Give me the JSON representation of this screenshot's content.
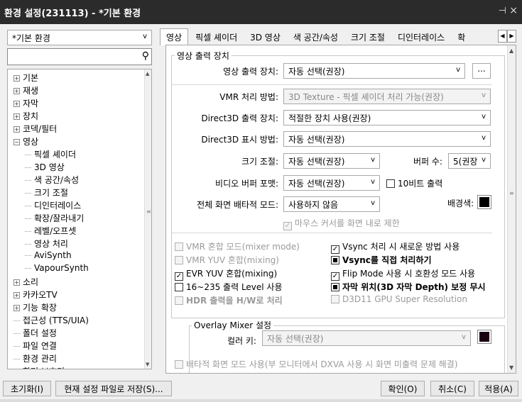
{
  "window": {
    "title": "환경 설정(231113) - *기본 환경",
    "pin_glyph": "⊣",
    "close_glyph": "×"
  },
  "left": {
    "profile": "*기본 환경",
    "search_placeholder": "",
    "tree": [
      {
        "label": "기본",
        "exp": "+",
        "indent": 0
      },
      {
        "label": "재생",
        "exp": "+",
        "indent": 0
      },
      {
        "label": "자막",
        "exp": "+",
        "indent": 0
      },
      {
        "label": "장치",
        "exp": "+",
        "indent": 0
      },
      {
        "label": "코덱/필터",
        "exp": "+",
        "indent": 0
      },
      {
        "label": "영상",
        "exp": "−",
        "indent": 0
      },
      {
        "label": "픽셀 셰이더",
        "exp": "",
        "indent": 1
      },
      {
        "label": "3D 영상",
        "exp": "",
        "indent": 1
      },
      {
        "label": "색 공간/속성",
        "exp": "",
        "indent": 1
      },
      {
        "label": "크기 조절",
        "exp": "",
        "indent": 1
      },
      {
        "label": "디인터레이스",
        "exp": "",
        "indent": 1
      },
      {
        "label": "확장/잘라내기",
        "exp": "",
        "indent": 1
      },
      {
        "label": "레벨/오프셋",
        "exp": "",
        "indent": 1
      },
      {
        "label": "영상 처리",
        "exp": "",
        "indent": 1
      },
      {
        "label": "AviSynth",
        "exp": "",
        "indent": 1
      },
      {
        "label": "VapourSynth",
        "exp": "",
        "indent": 1
      },
      {
        "label": "소리",
        "exp": "+",
        "indent": 0
      },
      {
        "label": "카카오TV",
        "exp": "+",
        "indent": 0
      },
      {
        "label": "기능 확장",
        "exp": "+",
        "indent": 0
      },
      {
        "label": "접근성 (TTS/UIA)",
        "exp": "",
        "indent": 0
      },
      {
        "label": "폴더 설정",
        "exp": "",
        "indent": 0
      },
      {
        "label": "파일 연결",
        "exp": "",
        "indent": 0
      },
      {
        "label": "환경 관리",
        "exp": "",
        "indent": 0
      },
      {
        "label": "화면 보호기",
        "exp": "",
        "indent": 0
      }
    ]
  },
  "tabs": [
    "영상",
    "픽셀 셰이더",
    "3D 영상",
    "색 공간/속성",
    "크기 조절",
    "디인터레이스",
    "확"
  ],
  "tabs_active_index": 0,
  "output_group": {
    "title": "영상 출력 장치",
    "device_label": "영상 출력 장치:",
    "device_value": "자동 선택(권장)",
    "browse_label": "...",
    "vmr_label": "VMR 처리 방법:",
    "vmr_value": "3D Texture - 픽셀 셰이더 처리 가능(권장)",
    "d3d_device_label": "Direct3D 출력 장치:",
    "d3d_device_value": "적절한 장치 사용(권장)",
    "d3d_present_label": "Direct3D 표시 방법:",
    "d3d_present_value": "자동 선택(권장)",
    "resize_label": "크기 조절:",
    "resize_value": "자동 선택(권장)",
    "buffer_label": "버퍼 수:",
    "buffer_value": "5(권장",
    "vbuf_label": "비디오 버퍼 포맷:",
    "vbuf_value": "자동 선택(권장)",
    "tenbit_label": "10비트 출력",
    "fs_label": "전체 화면 배타적 모드:",
    "fs_value": "사용하지 않음",
    "bg_label": "배경색:",
    "bg_color": "#000000",
    "mouse_label": "마우스 커서를 화면 내로 제한",
    "checks": [
      {
        "label": "VMR 혼합 모드(mixer mode)",
        "state": "off",
        "enabled": false,
        "bold": false
      },
      {
        "label": "Vsync 처리 시 새로운 방법 사용",
        "state": "on",
        "enabled": true,
        "bold": false
      },
      {
        "label": "VMR YUV 혼합(mixing)",
        "state": "off",
        "enabled": false,
        "bold": false
      },
      {
        "label": "Vsync를 직접 처리하기",
        "state": "partial",
        "enabled": true,
        "bold": true
      },
      {
        "label": "EVR YUV 혼합(mixing)",
        "state": "on",
        "enabled": true,
        "bold": false
      },
      {
        "label": "Flip Mode 사용 시 호환성 모드 사용",
        "state": "on",
        "enabled": true,
        "bold": false
      },
      {
        "label": "16~235 출력 Level 사용",
        "state": "off",
        "enabled": true,
        "bold": false
      },
      {
        "label": "자막 위치(3D 자막 Depth) 보정 무시",
        "state": "partial",
        "enabled": true,
        "bold": true
      },
      {
        "label": "HDR 출력을 H/W로 처리",
        "state": "off",
        "enabled": false,
        "bold": true
      },
      {
        "label": "D3D11 GPU Super Resolution",
        "state": "off",
        "enabled": false,
        "bold": false
      }
    ]
  },
  "overlay_group": {
    "title": "Overlay Mixer 설정",
    "colorkey_label": "컬러 키:",
    "colorkey_value": "자동 선택(권장)",
    "colorkey_color": "#1a0010",
    "exclusive_label": "배타적 화면 모드 사용(부 모니터에서 DXVA 사용 시 화면 미출력 문제 해결)"
  },
  "buttons": {
    "reset": "초기화(I)",
    "save_current": "현재 설정 파일로 저장(S)...",
    "ok": "확인(O)",
    "cancel": "취소(C)",
    "apply": "적용(A)"
  },
  "colors": {
    "titlebar": "#2b2b2b",
    "accent_check": "#000000"
  }
}
